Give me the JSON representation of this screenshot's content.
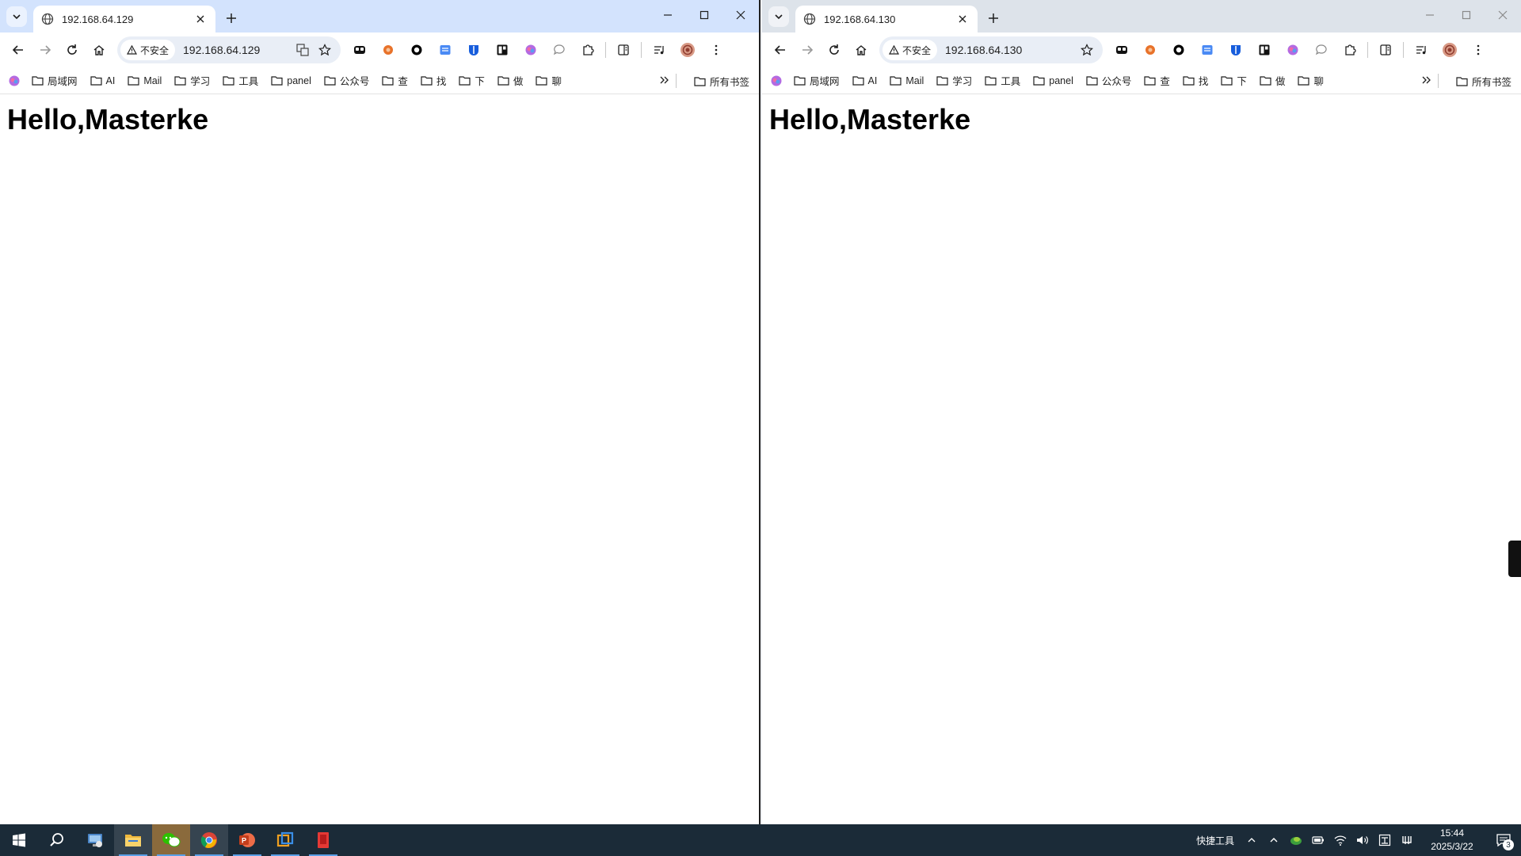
{
  "windows": [
    {
      "tab_title": "192.168.64.129",
      "security_chip": "不安全",
      "url": "192.168.64.129",
      "heading": "Hello,Masterke"
    },
    {
      "tab_title": "192.168.64.130",
      "security_chip": "不安全",
      "url": "192.168.64.130",
      "heading": "Hello,Masterke"
    }
  ],
  "bookmarks": [
    "局域网",
    "AI",
    "Mail",
    "学习",
    "工具",
    "panel",
    "公众号",
    "查",
    "找",
    "下",
    "做",
    "聊"
  ],
  "all_bookmarks": "所有书签",
  "taskbar": {
    "tray_label": "快捷工具",
    "time": "15:44",
    "date": "2025/3/22",
    "notification_count": "3"
  },
  "colors": {
    "active_tabstrip": "#d3e3fd",
    "inactive_tabstrip": "#dde3ea",
    "taskbar": "#1b2b38"
  }
}
